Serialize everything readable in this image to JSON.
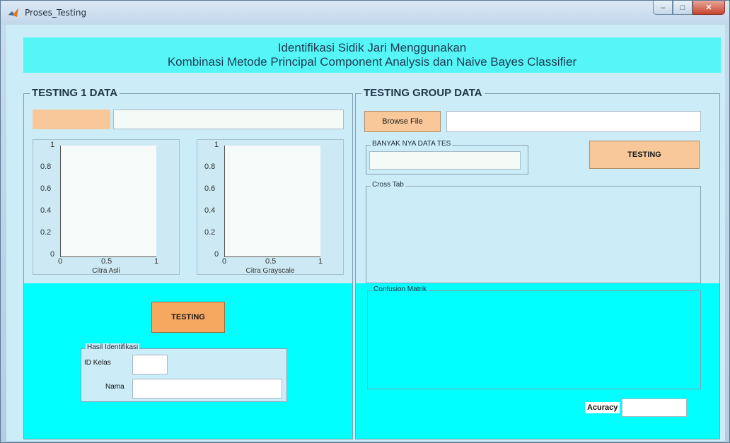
{
  "window": {
    "title": "Proses_Testing",
    "min": "–",
    "max": "□",
    "close": "✕"
  },
  "header": {
    "line1": "Identifikasi Sidik Jari Menggunakan",
    "line2": "Kombinasi Metode Principal Component Analysis dan Naive Bayes Classifier"
  },
  "left": {
    "title": "TESTING 1 DATA",
    "file_path": "",
    "axes": [
      {
        "caption": "Citra Asli",
        "yticks": [
          "1",
          "0.8",
          "0.6",
          "0.4",
          "0.2",
          "0"
        ],
        "xticks": [
          "0",
          "0.5",
          "1"
        ]
      },
      {
        "caption": "Citra Grayscale",
        "yticks": [
          "1",
          "0.8",
          "0.6",
          "0.4",
          "0.2",
          "0"
        ],
        "xticks": [
          "0",
          "0.5",
          "1"
        ]
      }
    ],
    "testing_button": "TESTING",
    "result": {
      "title": "Hasil Identifikasi",
      "id_label": "ID Kelas",
      "id_value": "",
      "name_label": "Nama",
      "name_value": ""
    }
  },
  "right": {
    "title": "TESTING GROUP DATA",
    "browse_button": "Browse File",
    "file_path": "",
    "count_group": {
      "title": "BANYAK NYA DATA TES",
      "value": ""
    },
    "testing_button": "TESTING",
    "crosstab_title": "Cross Tab",
    "confusion_title": "Confusion Matrik",
    "accuracy_label": "Acuracy",
    "accuracy_value": ""
  },
  "colors": {
    "accent_cyan": "#00ffff",
    "button": "#f8c89a",
    "header": "#56f6f6"
  }
}
